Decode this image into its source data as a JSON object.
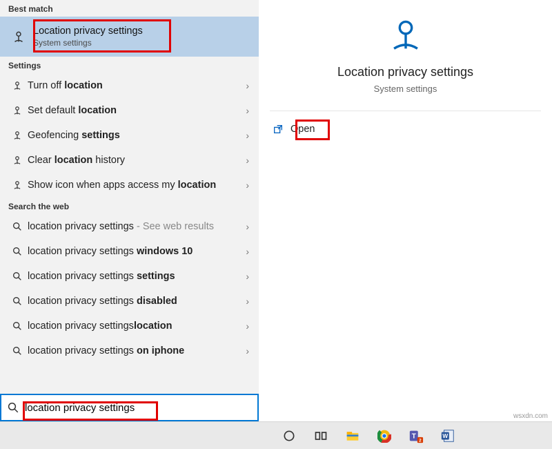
{
  "sections": {
    "best_match_label": "Best match",
    "settings_label": "Settings",
    "web_label": "Search the web"
  },
  "best_match": {
    "title": "Location privacy settings",
    "sub": "System settings"
  },
  "settings_items": [
    {
      "pre": "Turn off ",
      "bold": "location",
      "post": ""
    },
    {
      "pre": "Set default ",
      "bold": "location",
      "post": ""
    },
    {
      "pre": "Geofencing ",
      "bold": "settings",
      "post": ""
    },
    {
      "pre": "Clear ",
      "bold": "location",
      "post": " history"
    },
    {
      "pre": "Show icon when apps access my ",
      "bold": "location",
      "post": ""
    }
  ],
  "web_items": [
    {
      "text": "location privacy settings",
      "suffix_light": " - See web results",
      "bold_tail": ""
    },
    {
      "text": "location privacy settings ",
      "bold_tail": "windows 10"
    },
    {
      "text": "location privacy settings ",
      "bold_tail": "settings"
    },
    {
      "text": "location privacy settings ",
      "bold_tail": "disabled"
    },
    {
      "text": "location privacy settings",
      "bold_tail": "location"
    },
    {
      "text": "location privacy settings ",
      "bold_tail": "on iphone"
    }
  ],
  "search_input": {
    "value": "location privacy settings"
  },
  "details": {
    "title": "Location privacy settings",
    "sub": "System settings",
    "open": "Open"
  },
  "watermark": "wsxdn.com"
}
